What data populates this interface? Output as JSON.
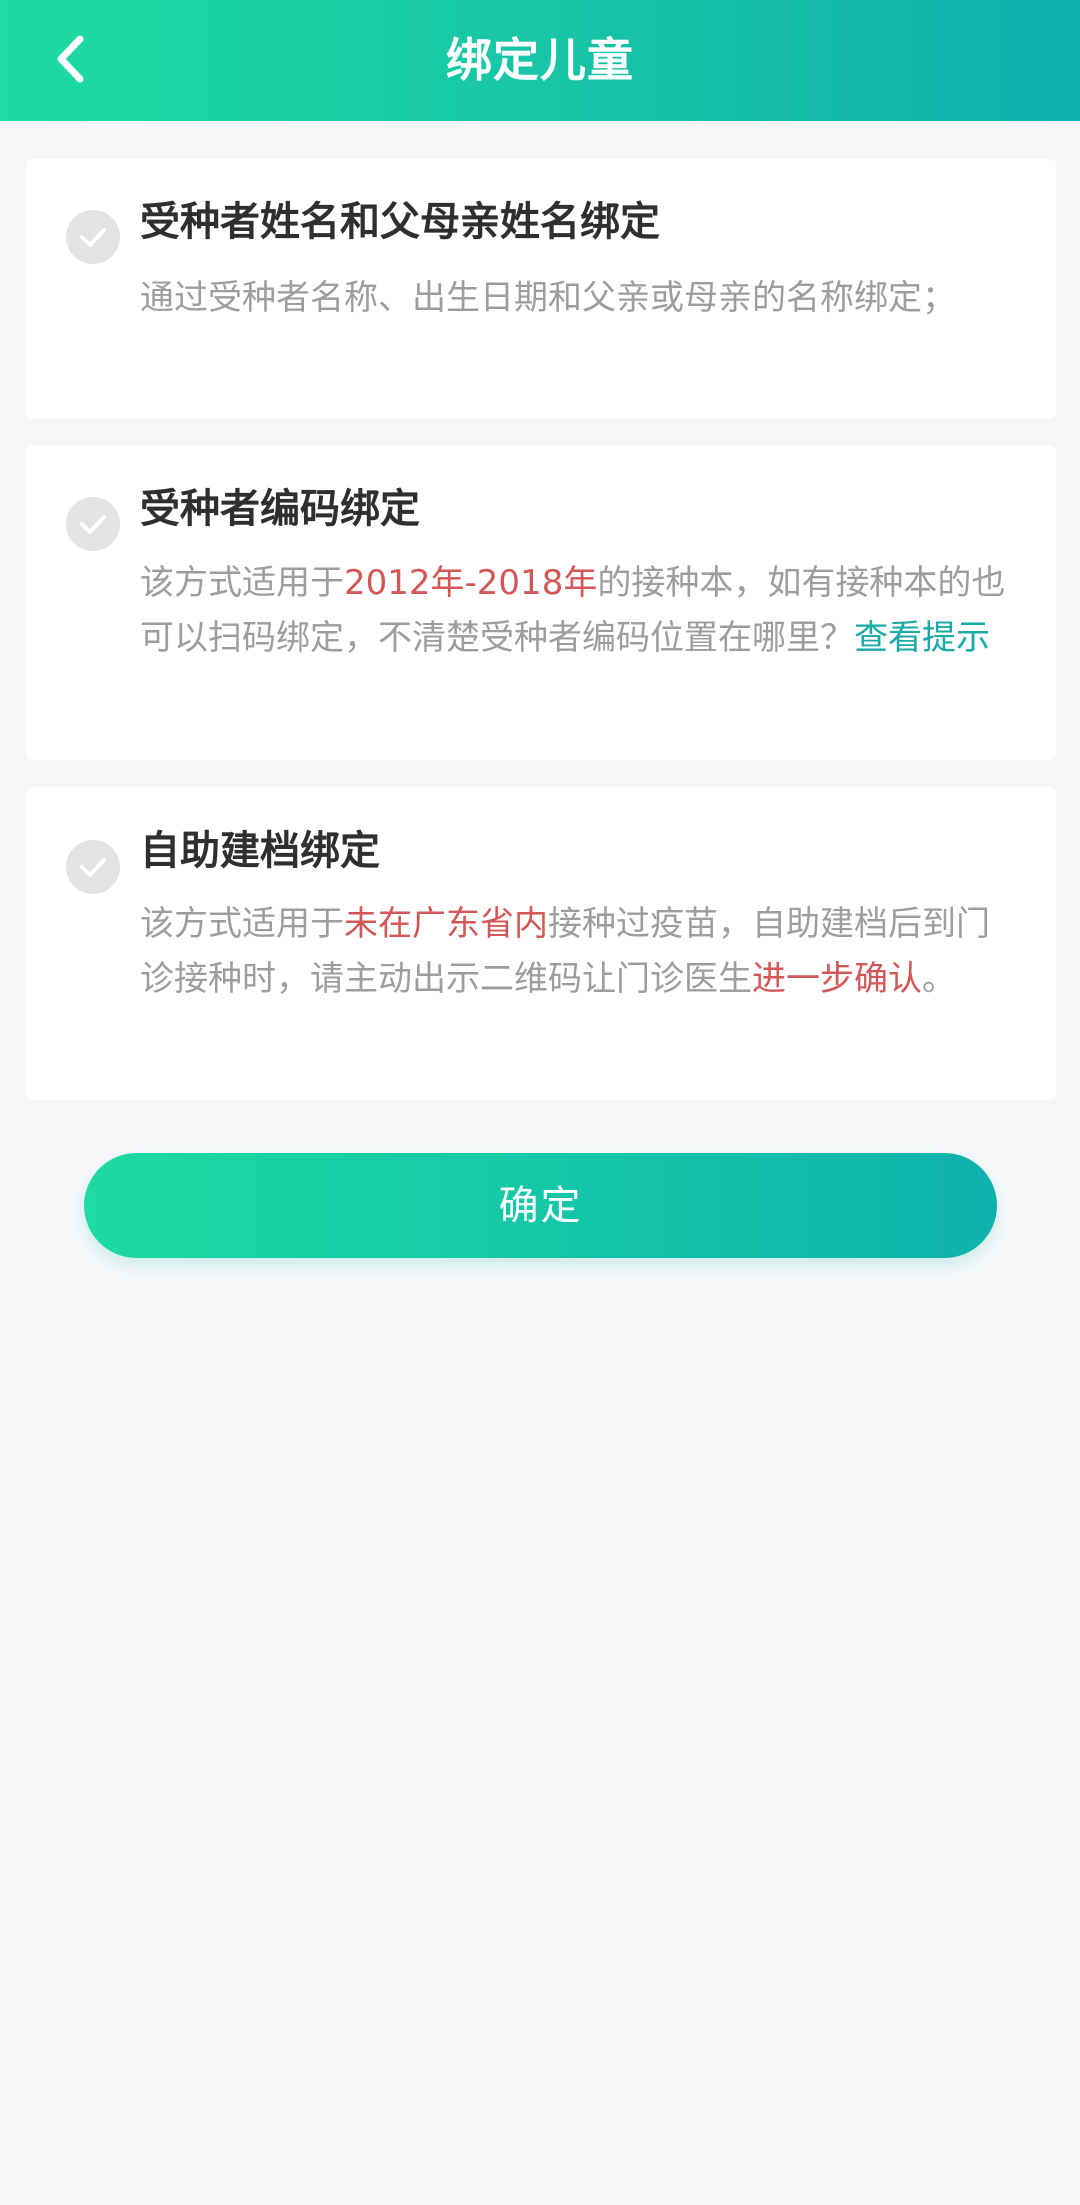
{
  "header": {
    "title": "绑定儿童",
    "back_icon": "chevron-left-icon",
    "color": "#17c3a6"
  },
  "options": [
    {
      "title": "受种者姓名和父母亲姓名绑定",
      "desc_parts": [
        "通过受种者名称、出生日期和父亲或母亲的名称绑定；"
      ],
      "check_icon": "check-circle-icon",
      "selected": false
    },
    {
      "title": "受种者编码绑定",
      "desc_parts": [
        "该方式适用于",
        "2012年-2018年",
        "的接种本，如有接种本的也可以扫码绑定，不清楚受种者编码位置在哪里？",
        "查看提示"
      ],
      "check_icon": "check-circle-icon",
      "selected": false
    },
    {
      "title": "自助建档绑定",
      "desc_parts": [
        "该方式适用于",
        "未在广东省内",
        "接种过疫苗，自助建档后到门诊接种时，请主动出示二维码让门诊医生",
        "进一步确认",
        "。"
      ],
      "check_icon": "check-circle-icon",
      "selected": false
    }
  ],
  "confirm": {
    "label": "确定"
  },
  "colors": {
    "accent": "#1ddba2",
    "accent_dark": "#0eb0ad",
    "highlight_red": "#d45757",
    "link_teal": "#17aaa6"
  }
}
